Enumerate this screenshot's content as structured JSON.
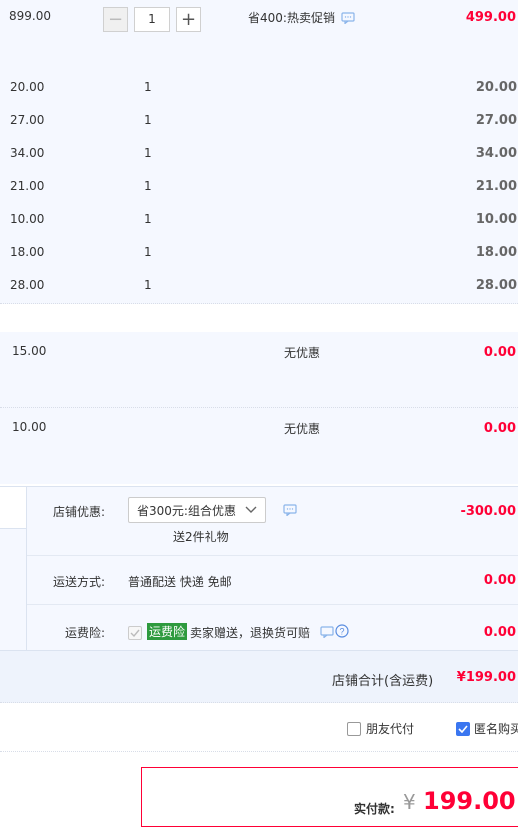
{
  "main_item": {
    "unit_price": "899.00",
    "quantity": "1",
    "promo": "省400:热卖促销",
    "subtotal": "499.00"
  },
  "gift_items": [
    {
      "price": "20.00",
      "qty": "1",
      "subtotal": "20.00"
    },
    {
      "price": "27.00",
      "qty": "1",
      "subtotal": "27.00"
    },
    {
      "price": "34.00",
      "qty": "1",
      "subtotal": "34.00"
    },
    {
      "price": "21.00",
      "qty": "1",
      "subtotal": "21.00"
    },
    {
      "price": "10.00",
      "qty": "1",
      "subtotal": "10.00"
    },
    {
      "price": "18.00",
      "qty": "1",
      "subtotal": "18.00"
    },
    {
      "price": "28.00",
      "qty": "1",
      "subtotal": "28.00"
    }
  ],
  "extra_items": [
    {
      "price": "15.00",
      "promo": "无优惠",
      "subtotal": "0.00"
    },
    {
      "price": "10.00",
      "promo": "无优惠",
      "subtotal": "0.00"
    }
  ],
  "shop": {
    "discount_label": "店铺优惠:",
    "discount_select": "省300元:组合优惠",
    "discount_gift": "送2件礼物",
    "discount_amount": "-300.00",
    "shipping_label": "运送方式:",
    "shipping_value": "普通配送 快递 免邮",
    "shipping_amount": "0.00",
    "insurance_label": "运费险:",
    "insurance_tag": "运费险",
    "insurance_desc": "卖家赠送，退换货可赔",
    "insurance_amount": "0.00",
    "total_label": "店铺合计(含运费)",
    "total_amount": "¥199.00"
  },
  "options": {
    "friend_pay": "朋友代付",
    "anonymous": "匿名购买",
    "anonymous_checked": true
  },
  "payment": {
    "label": "实付款:",
    "currency": "¥",
    "amount": "199.00"
  },
  "colors": {
    "accent_red": "#ff0036",
    "panel_blue": "#f5f8ff",
    "check_blue": "#3a76f0",
    "insurance_green": "#2e9a3e"
  }
}
